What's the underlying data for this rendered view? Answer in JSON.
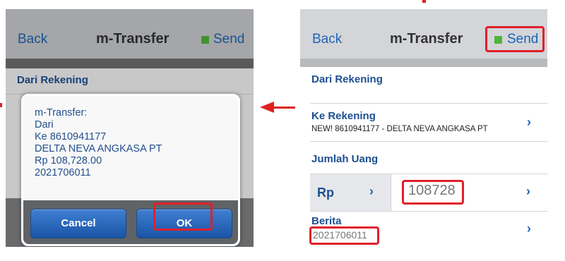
{
  "left": {
    "nav": {
      "back": "Back",
      "title": "m-Transfer",
      "send": "Send"
    },
    "section_from": "Dari Rekening",
    "dialog": {
      "lines": [
        "m-Transfer:",
        "Dari",
        "Ke 8610941177",
        "DELTA NEVA ANGKASA PT",
        "Rp 108,728.00",
        "2021706011"
      ],
      "cancel": "Cancel",
      "ok": "OK"
    }
  },
  "right": {
    "nav": {
      "back": "Back",
      "title": "m-Transfer",
      "send": "Send"
    },
    "from_label": "Dari Rekening",
    "to_label": "Ke Rekening",
    "to_value": "NEW! 8610941177 - DELTA NEVA ANGKASA PT",
    "amount_label": "Jumlah Uang",
    "currency": "Rp",
    "amount": "108728",
    "message_label": "Berita",
    "message_value": "2021706011"
  },
  "colors": {
    "accent": "#1f64b5",
    "highlight": "#e0202a",
    "send_indicator": "#4db53a"
  }
}
